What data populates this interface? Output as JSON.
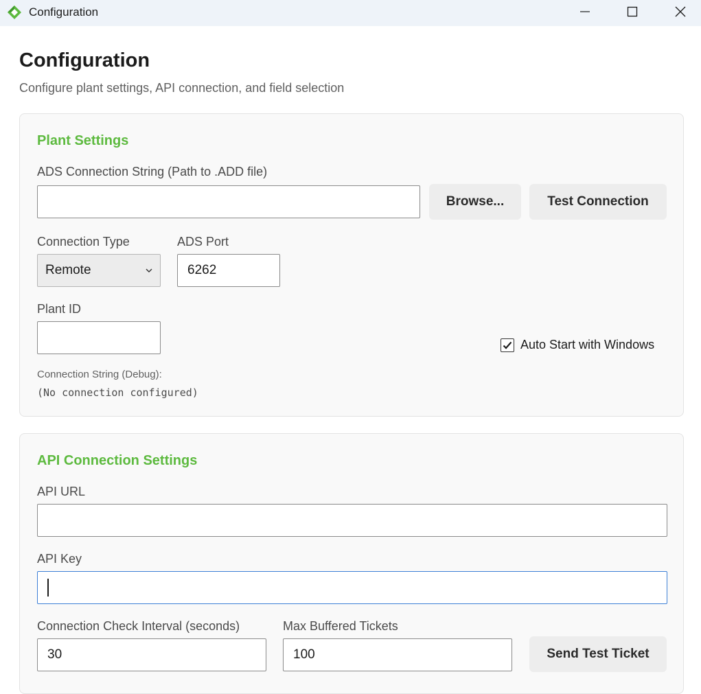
{
  "window": {
    "title": "Configuration",
    "accent_color": "#5dba3f"
  },
  "header": {
    "title": "Configuration",
    "subtitle": "Configure plant settings, API connection, and field selection"
  },
  "plant_settings": {
    "section_title": "Plant Settings",
    "ads_connection_label": "ADS Connection String (Path to .ADD file)",
    "ads_connection_value": "",
    "browse_label": "Browse...",
    "test_connection_label": "Test Connection",
    "connection_type_label": "Connection Type",
    "connection_type_value": "Remote",
    "ads_port_label": "ADS Port",
    "ads_port_value": "6262",
    "plant_id_label": "Plant ID",
    "plant_id_value": "",
    "auto_start_label": "Auto Start with Windows",
    "auto_start_checked": true,
    "debug_label": "Connection String (Debug):",
    "debug_value": "(No connection configured)"
  },
  "api_settings": {
    "section_title": "API Connection Settings",
    "api_url_label": "API URL",
    "api_url_value": "",
    "api_key_label": "API Key",
    "api_key_value": "",
    "check_interval_label": "Connection Check Interval (seconds)",
    "check_interval_value": "30",
    "max_buffered_label": "Max Buffered Tickets",
    "max_buffered_value": "100",
    "send_test_label": "Send Test Ticket"
  }
}
